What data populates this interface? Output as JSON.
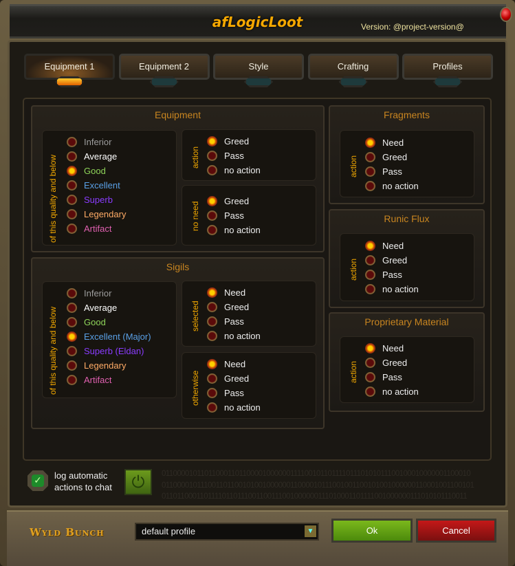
{
  "window": {
    "title": "afLogicLoot",
    "version": "Version: @project-version@"
  },
  "tabs": [
    {
      "label": "Equipment 1",
      "active": true
    },
    {
      "label": "Equipment 2",
      "active": false
    },
    {
      "label": "Style",
      "active": false
    },
    {
      "label": "Crafting",
      "active": false
    },
    {
      "label": "Profiles",
      "active": false
    }
  ],
  "quality_colors": {
    "Inferior": "#9d9d9d",
    "Average": "#ffffff",
    "Good": "#8fd45a",
    "Excellent": "#5aa0e6",
    "Superb": "#8a3cff",
    "Legendary": "#ffab66",
    "Artifact": "#e060b0"
  },
  "panels": {
    "equipment": {
      "title": "Equipment",
      "quality": {
        "label": "of this quality and below",
        "options": [
          "Inferior",
          "Average",
          "Good",
          "Excellent",
          "Superb",
          "Legendary",
          "Artifact"
        ],
        "selected": 2
      },
      "action": {
        "label": "action",
        "options": [
          "Greed",
          "Pass",
          "no action"
        ],
        "selected": 0
      },
      "no_need": {
        "label": "no need",
        "options": [
          "Greed",
          "Pass",
          "no action"
        ],
        "selected": 0
      }
    },
    "sigils": {
      "title": "Sigils",
      "quality": {
        "label": "of this quality and below",
        "options": [
          "Inferior",
          "Average",
          "Good",
          "Excellent (Major)",
          "Superb (Eldan)",
          "Legendary",
          "Artifact"
        ],
        "selected": 3
      },
      "selected": {
        "label": "selected",
        "options": [
          "Need",
          "Greed",
          "Pass",
          "no action"
        ],
        "selected": 0
      },
      "otherwise": {
        "label": "otherwise",
        "options": [
          "Need",
          "Greed",
          "Pass",
          "no action"
        ],
        "selected": 0
      }
    },
    "fragments": {
      "title": "Fragments",
      "action": {
        "label": "action",
        "options": [
          "Need",
          "Greed",
          "Pass",
          "no action"
        ],
        "selected": 0
      }
    },
    "runic_flux": {
      "title": "Runic Flux",
      "action": {
        "label": "action",
        "options": [
          "Need",
          "Greed",
          "Pass",
          "no action"
        ],
        "selected": 0
      }
    },
    "proprietary": {
      "title": "Proprietary Material",
      "action": {
        "label": "action",
        "options": [
          "Need",
          "Greed",
          "Pass",
          "no action"
        ],
        "selected": 0
      }
    }
  },
  "footer": {
    "log_checkbox": {
      "label_line1": "log automatic",
      "label_line2": "actions to chat",
      "checked": true
    },
    "power_icon": "power-icon",
    "binary": [
      "01100001011011000110110000100000011110010110111101110101011100100010000001100010",
      "01100001011100110110010100100000011000010111001001100101001000000110001001100101",
      "01101100011011110110111001100111001000000111010001101111001000000111010101110011"
    ]
  },
  "bottom": {
    "brand": "Wyld Bunch",
    "profile": "default profile",
    "ok_label": "Ok",
    "cancel_label": "Cancel"
  }
}
